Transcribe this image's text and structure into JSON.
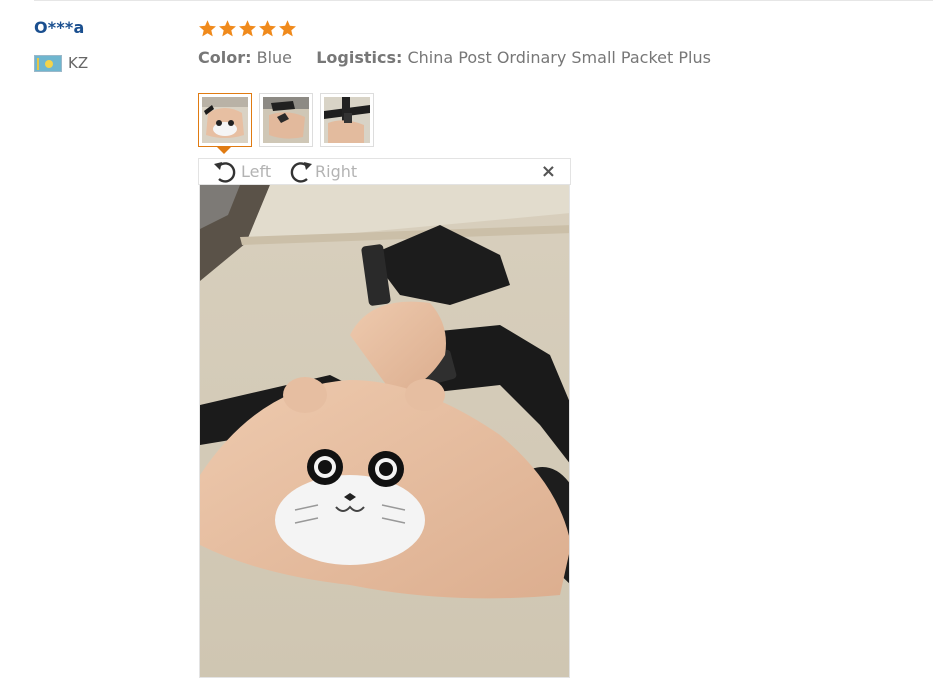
{
  "review": {
    "user_name": "O***a",
    "country_code": "KZ",
    "rating": 5,
    "attributes": [
      {
        "label": "Color:",
        "value": "Blue"
      },
      {
        "label": "Logistics:",
        "value": "China Post Ordinary Small Packet Plus"
      }
    ]
  },
  "colors": {
    "star": "#f08a1c",
    "user_name": "#1a4f8f",
    "active_thumb_border": "#e07b12"
  },
  "viewer": {
    "rotate_left_label": "Left",
    "rotate_right_label": "Right",
    "close_symbol": "×",
    "selected_thumb_index": 0,
    "thumb_count": 3
  },
  "icons": {
    "rotate_left": "rotate-left-icon",
    "rotate_right": "rotate-right-icon",
    "close": "close-icon",
    "flag": "kazakhstan-flag-icon",
    "star": "star-icon"
  }
}
